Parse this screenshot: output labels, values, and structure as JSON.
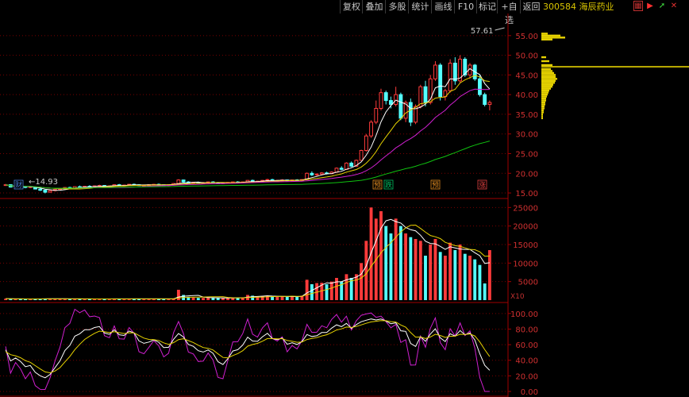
{
  "toolbar": {
    "buttons": [
      "复权",
      "叠加",
      "多股",
      "统计",
      "画线",
      "F10",
      "标记",
      "+自选",
      "返回"
    ],
    "ticker": "300584 海辰药业",
    "icons": [
      "grid-icon",
      "flag-icon",
      "arrow-icon",
      "close-icon"
    ]
  },
  "main_panel": {
    "price_labels": [
      "55.00",
      "50.00",
      "45.00",
      "40.00",
      "35.00",
      "30.00",
      "25.00",
      "20.00",
      "15.00"
    ],
    "max_label": "57.61",
    "min_label": "14.93",
    "markers": [
      {
        "text": "财",
        "color": "#4a7bd6"
      },
      {
        "text": "预",
        "color": "#e08a20"
      },
      {
        "text": "跌",
        "color": "#00c060"
      },
      {
        "text": "预",
        "color": "#e08a20"
      },
      {
        "text": "涨",
        "color": "#e04040"
      }
    ]
  },
  "volume_panel": {
    "labels": [
      "25000",
      "20000",
      "15000",
      "10000",
      "5000"
    ],
    "unit": "X10"
  },
  "osc_panel": {
    "labels": [
      "100.00",
      "80.00",
      "60.00",
      "40.00",
      "20.00",
      "0.00"
    ]
  },
  "colors": {
    "up": "#ff3b3b",
    "down": "#54ffff",
    "grid": "#7a0000",
    "axis": "#a00000",
    "ma5": "#ffffff",
    "ma10": "#e6d200",
    "ma20": "#d020d0",
    "ma60": "#10c010"
  },
  "chart_data": {
    "type": "candlestick",
    "price_ylim": [
      14,
      59
    ],
    "volume_ylim": [
      0,
      27000
    ],
    "osc_ylim": [
      0,
      110
    ],
    "bars": [
      [
        17,
        17.3,
        16.8,
        17.1,
        400
      ],
      [
        17.1,
        17.2,
        16.4,
        16.5,
        350
      ],
      [
        16.6,
        16.9,
        16.3,
        16.8,
        300
      ],
      [
        16.8,
        17.0,
        16.5,
        16.6,
        280
      ],
      [
        16.6,
        16.8,
        16.2,
        16.4,
        260
      ],
      [
        16.4,
        16.7,
        16.2,
        16.6,
        300
      ],
      [
        16.5,
        16.6,
        15.9,
        16.0,
        350
      ],
      [
        16.0,
        16.2,
        15.5,
        15.7,
        400
      ],
      [
        15.7,
        15.9,
        14.9,
        15.2,
        420
      ],
      [
        15.2,
        15.8,
        15.1,
        15.6,
        380
      ],
      [
        15.6,
        16.0,
        15.4,
        15.9,
        360
      ],
      [
        15.9,
        16.3,
        15.7,
        16.1,
        340
      ],
      [
        16.1,
        16.5,
        15.9,
        16.4,
        330
      ],
      [
        16.4,
        16.6,
        16.1,
        16.2,
        320
      ],
      [
        16.2,
        16.7,
        16.1,
        16.6,
        330
      ],
      [
        16.6,
        16.9,
        16.4,
        16.5,
        310
      ],
      [
        16.5,
        16.8,
        16.3,
        16.7,
        300
      ],
      [
        16.7,
        17.0,
        16.5,
        16.6,
        300
      ],
      [
        16.6,
        16.9,
        16.4,
        16.8,
        320
      ],
      [
        16.8,
        17.1,
        16.6,
        16.9,
        350
      ],
      [
        16.9,
        17.0,
        16.5,
        16.6,
        330
      ],
      [
        16.6,
        16.9,
        16.5,
        16.8,
        320
      ],
      [
        16.8,
        17.2,
        16.7,
        17.1,
        360
      ],
      [
        17.1,
        17.3,
        16.8,
        16.9,
        340
      ],
      [
        16.9,
        17.1,
        16.7,
        17.0,
        330
      ],
      [
        17.0,
        17.3,
        16.9,
        17.2,
        360
      ],
      [
        17.2,
        17.4,
        17.0,
        17.1,
        350
      ],
      [
        17.1,
        17.2,
        16.8,
        16.9,
        340
      ],
      [
        16.9,
        17.1,
        16.7,
        17.0,
        320
      ],
      [
        17.0,
        17.2,
        16.8,
        17.1,
        330
      ],
      [
        17.1,
        17.3,
        16.9,
        17.2,
        340
      ],
      [
        17.2,
        17.4,
        17.0,
        17.1,
        350
      ],
      [
        17.1,
        17.2,
        16.9,
        17.0,
        330
      ],
      [
        17.0,
        17.2,
        16.8,
        17.1,
        320
      ],
      [
        17.1,
        17.5,
        17.0,
        17.4,
        400
      ],
      [
        17.4,
        18.5,
        17.3,
        18.3,
        2800
      ],
      [
        18.3,
        18.4,
        17.6,
        17.8,
        1400
      ],
      [
        17.8,
        18.0,
        17.4,
        17.5,
        900
      ],
      [
        17.5,
        17.8,
        17.3,
        17.7,
        700
      ],
      [
        17.7,
        17.9,
        17.4,
        17.5,
        600
      ],
      [
        17.5,
        17.8,
        17.3,
        17.6,
        600
      ],
      [
        17.6,
        17.9,
        17.4,
        17.8,
        650
      ],
      [
        17.8,
        18.0,
        17.5,
        17.6,
        620
      ],
      [
        17.6,
        17.8,
        17.4,
        17.5,
        600
      ],
      [
        17.5,
        17.7,
        17.3,
        17.6,
        580
      ],
      [
        17.6,
        17.8,
        17.4,
        17.7,
        600
      ],
      [
        17.7,
        17.9,
        17.5,
        17.8,
        650
      ],
      [
        17.8,
        18.0,
        17.6,
        17.7,
        640
      ],
      [
        17.7,
        17.9,
        17.5,
        17.8,
        660
      ],
      [
        17.8,
        18.3,
        17.7,
        18.2,
        1400
      ],
      [
        18.2,
        18.4,
        17.8,
        17.9,
        1200
      ],
      [
        17.9,
        18.1,
        17.7,
        18.0,
        1000
      ],
      [
        18.0,
        18.3,
        17.9,
        18.2,
        1100
      ],
      [
        18.2,
        18.6,
        18.1,
        18.4,
        1200
      ],
      [
        18.4,
        18.6,
        18.0,
        18.1,
        1000
      ],
      [
        18.1,
        18.3,
        17.9,
        18.2,
        900
      ],
      [
        18.2,
        18.5,
        18.0,
        18.3,
        950
      ],
      [
        18.3,
        18.4,
        18.0,
        18.1,
        900
      ],
      [
        18.1,
        18.4,
        18.0,
        18.3,
        1100
      ],
      [
        18.3,
        18.5,
        18.1,
        18.2,
        1000
      ],
      [
        18.2,
        18.5,
        18.1,
        18.4,
        1200
      ],
      [
        18.4,
        20.2,
        18.3,
        20.0,
        5500
      ],
      [
        20.0,
        20.5,
        19.3,
        19.6,
        4300
      ],
      [
        19.6,
        20.0,
        19.2,
        19.8,
        4600
      ],
      [
        19.8,
        20.3,
        19.6,
        20.1,
        4700
      ],
      [
        20.1,
        20.4,
        19.7,
        19.9,
        4300
      ],
      [
        19.9,
        20.5,
        19.8,
        20.3,
        5000
      ],
      [
        20.3,
        21.5,
        20.2,
        21.3,
        6000
      ],
      [
        21.3,
        21.8,
        20.8,
        21.0,
        5000
      ],
      [
        21.0,
        22.8,
        20.9,
        22.6,
        7000
      ],
      [
        22.6,
        23.0,
        21.6,
        21.8,
        6000
      ],
      [
        21.8,
        23.5,
        21.7,
        23.3,
        7000
      ],
      [
        23.3,
        26.0,
        23.2,
        25.8,
        10000
      ],
      [
        25.8,
        30.0,
        25.5,
        29.5,
        16000
      ],
      [
        29.5,
        33.5,
        29.0,
        33.0,
        25000
      ],
      [
        33.0,
        38.5,
        32.5,
        36.5,
        22000
      ],
      [
        36.5,
        41.5,
        36.0,
        40.5,
        24000
      ],
      [
        40.5,
        41.0,
        37.5,
        38.5,
        20000
      ],
      [
        38.5,
        39.5,
        36.5,
        37.5,
        18000
      ],
      [
        37.5,
        42.0,
        37.0,
        40.0,
        22000
      ],
      [
        40.0,
        40.5,
        33.5,
        34.0,
        20000
      ],
      [
        34.0,
        38.5,
        33.0,
        38.0,
        18000
      ],
      [
        38.0,
        39.0,
        32.0,
        33.0,
        17000
      ],
      [
        33.0,
        37.5,
        32.5,
        37.0,
        16500
      ],
      [
        37.0,
        42.5,
        36.5,
        42.0,
        16000
      ],
      [
        42.0,
        43.5,
        37.0,
        38.0,
        12000
      ],
      [
        38.0,
        45.0,
        37.5,
        44.0,
        15000
      ],
      [
        44.0,
        48.5,
        43.5,
        47.5,
        16500
      ],
      [
        47.5,
        48.0,
        38.5,
        39.5,
        13000
      ],
      [
        39.5,
        41.5,
        38.5,
        41.0,
        12000
      ],
      [
        41.0,
        49.0,
        40.5,
        48.0,
        15500
      ],
      [
        48.0,
        49.5,
        42.5,
        43.5,
        13500
      ],
      [
        43.5,
        50.0,
        43.0,
        49.0,
        15000
      ],
      [
        49.0,
        49.5,
        44.5,
        45.0,
        12500
      ],
      [
        45.0,
        48.0,
        44.0,
        47.5,
        12000
      ],
      [
        47.5,
        47.8,
        43.5,
        44.0,
        11000
      ],
      [
        44.0,
        45.0,
        39.5,
        40.0,
        9500
      ],
      [
        40.0,
        40.5,
        37.0,
        37.5,
        4500
      ],
      [
        37.5,
        38.5,
        36.0,
        38.0,
        13500
      ]
    ]
  }
}
